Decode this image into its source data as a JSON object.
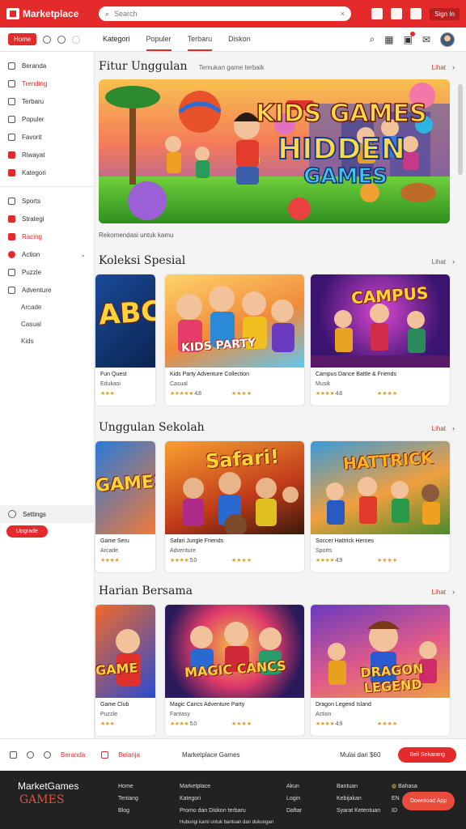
{
  "topbar": {
    "brand": "Marketplace",
    "search_placeholder": "Search",
    "user_label": "Sign In"
  },
  "subbar": {
    "home_label": "Home",
    "tabs": [
      "Kategori",
      "Populer",
      "Terbaru",
      "Diskon"
    ]
  },
  "sidebar": {
    "group1": [
      "Beranda",
      "Trending",
      "Terbaru",
      "Populer",
      "Favorit",
      "Riwayat",
      "Kategori"
    ],
    "group2": [
      "Sports",
      "Strategi",
      "Racing",
      "Action"
    ],
    "subitems": [
      "Puzzle",
      "Adventure",
      "Arcade",
      "Casual",
      "Kids"
    ],
    "bottom_label": "Settings",
    "cta": "Upgrade"
  },
  "hero_section": {
    "title": "Fitur Unggulan",
    "subtitle": "Temukan game terbaik",
    "more": "Lihat",
    "hero_text_line1": "KIDS GAMES",
    "hero_text_line2": "HIDDEN",
    "hero_text_line3": "GAMES",
    "caption": "Rekomendasi untuk kamu"
  },
  "sections": [
    {
      "title": "Koleksi Spesial",
      "more": "Lihat",
      "cards": [
        {
          "thumb_text": "ABC",
          "title": "Fun Quest",
          "subtitle": "Edukasi",
          "stars": "★★★",
          "rating": ""
        },
        {
          "thumb_text": "KIDS PARTY",
          "title": "Kids Party Adventure Collection",
          "subtitle": "Casual",
          "stars": "★★★★★",
          "rating": "4.8",
          "stars2": "★★★★"
        },
        {
          "thumb_text": "CAMPUS",
          "title": "Campus Dance Battle & Friends",
          "subtitle": "Musik",
          "stars": "★★★★",
          "rating": "4.6",
          "stars2": "★★★★"
        }
      ]
    },
    {
      "title": "Unggulan Sekolah",
      "more": "Lihat",
      "cards": [
        {
          "thumb_text": "GAMES",
          "title": "Game Seru",
          "subtitle": "Arcade",
          "stars": "★★★★",
          "rating": ""
        },
        {
          "thumb_text": "Safari!",
          "title": "Safari Jungle Friends",
          "subtitle": "Adventure",
          "stars": "★★★★",
          "rating": "5.0",
          "stars2": "★★★★"
        },
        {
          "thumb_text": "HATTRICK",
          "title": "Soccer Hattrick Heroes",
          "subtitle": "Sports",
          "stars": "★★★★",
          "rating": "4.9",
          "stars2": "★★★★"
        }
      ]
    },
    {
      "title": "Harian Bersama",
      "more": "Lihat",
      "cards": [
        {
          "thumb_text": "GAME",
          "title": "Game Club",
          "subtitle": "Puzzle",
          "stars": "★★★",
          "rating": ""
        },
        {
          "thumb_text": "MAGIC CANCS",
          "title": "Magic Cancs Adventure Party",
          "subtitle": "Fantasy",
          "stars": "★★★★",
          "rating": "5.0",
          "stars2": "★★★★"
        },
        {
          "thumb_text": "DRAGON LEGEND",
          "title": "Dragon Legend Island",
          "subtitle": "Action",
          "stars": "★★★★",
          "rating": "4.9",
          "stars2": "★★★★"
        }
      ]
    }
  ],
  "bottombar": {
    "items": [
      "Beranda",
      "Belanja"
    ],
    "center": "Marketplace Games",
    "price": "Mulai dari $60",
    "cta": "Beli Sekarang"
  },
  "footer": {
    "brand": "MarketGames",
    "brand2": "GAMES",
    "col1": [
      "Home",
      "Tentang",
      "Blog"
    ],
    "col2": [
      "Marketplace",
      "Kategori",
      "Promo dan Diskon terbaru",
      "Hubungi kami untuk bantuan dan dukungan"
    ],
    "col3": [
      "Akun",
      "Login",
      "Daftar"
    ],
    "col4": [
      "Bantuan",
      "Kebijakan",
      "Syarat Ketentuan"
    ],
    "col5": [
      "Bahasa",
      "EN",
      "ID"
    ],
    "cta": "Download App"
  },
  "colors": {
    "accent": "#e42a2a",
    "footer_bg": "#222222"
  }
}
